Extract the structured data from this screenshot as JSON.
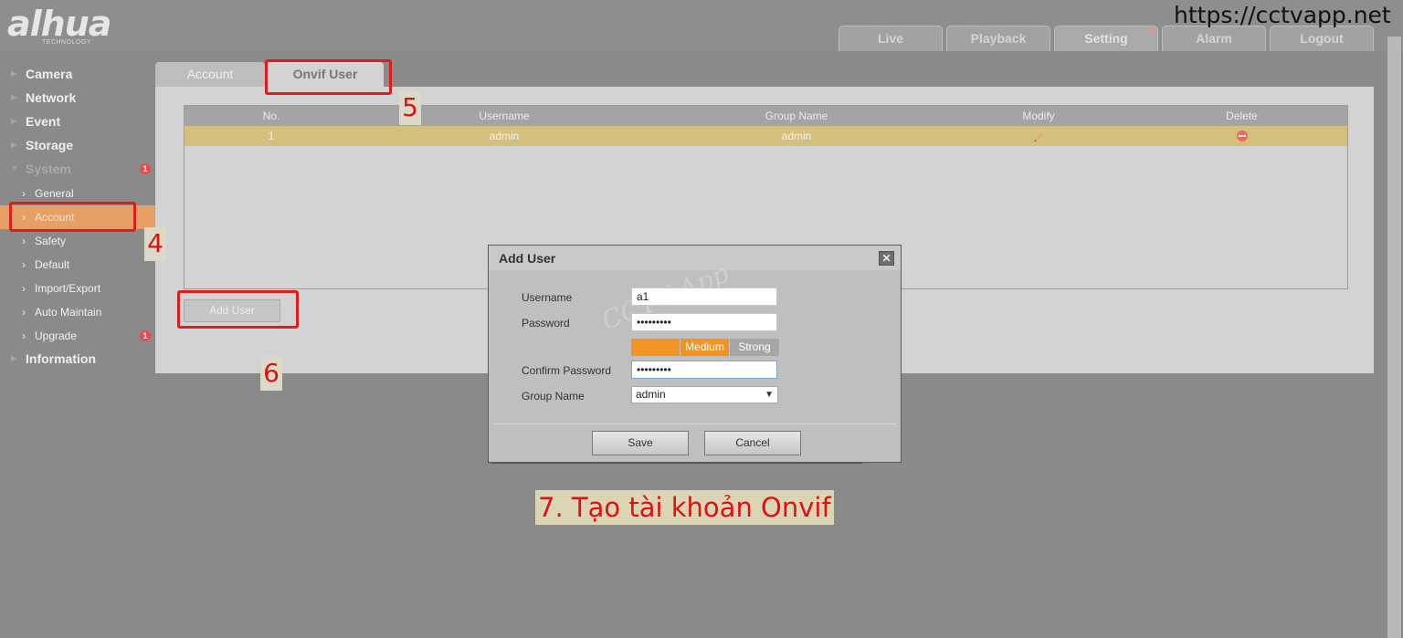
{
  "brand": {
    "name": "alhua",
    "tagline": "TECHNOLOGY"
  },
  "watermark_url": "https://cctvapp.net",
  "topnav": [
    {
      "label": "Live"
    },
    {
      "label": "Playback"
    },
    {
      "label": "Setting"
    },
    {
      "label": "Alarm"
    },
    {
      "label": "Logout"
    }
  ],
  "sidebar": {
    "camera": "Camera",
    "network": "Network",
    "event": "Event",
    "storage": "Storage",
    "system": "System",
    "system_badge": "1",
    "general": "General",
    "account": "Account",
    "safety": "Safety",
    "default": "Default",
    "import_export": "Import/Export",
    "auto_maintain": "Auto Maintain",
    "upgrade": "Upgrade",
    "upgrade_badge": "1",
    "information": "Information"
  },
  "subtabs": {
    "account": "Account",
    "onvif_user": "Onvif User"
  },
  "table": {
    "headers": {
      "no": "No.",
      "username": "Username",
      "group": "Group Name",
      "modify": "Modify",
      "delete": "Delete"
    },
    "rows": [
      {
        "no": "1",
        "username": "admin",
        "group": "admin"
      }
    ]
  },
  "add_user_button": "Add User",
  "steps": {
    "s4": "4",
    "s5": "5",
    "s6": "6"
  },
  "dialog": {
    "title": "Add User",
    "username_label": "Username",
    "username_value": "a1",
    "password_label": "Password",
    "password_value": "•••••••••",
    "strength_weak": "",
    "strength_medium": "Medium",
    "strength_strong": "Strong",
    "confirm_label": "Confirm Password",
    "confirm_value": "•••••••••",
    "group_label": "Group Name",
    "group_value": "admin",
    "save": "Save",
    "cancel": "Cancel",
    "watermark": "CCTV App"
  },
  "caption": "7. Tạo tài khoản Onvif",
  "colors": {
    "accent_orange": "#f29425",
    "active_row": "#d4c07e",
    "annotation_red": "#e21b1b"
  }
}
